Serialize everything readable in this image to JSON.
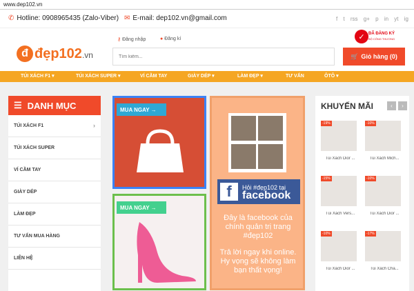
{
  "browser": {
    "url": "www.dep102.vn"
  },
  "topbar": {
    "hotline": "Hotline: 0908965435 (Zalo-Viber)",
    "email": "E-mail: dep102.vn@gmail.com",
    "socials": [
      "f",
      "t",
      "rss",
      "g+",
      "p",
      "in",
      "yt",
      "ig"
    ]
  },
  "header": {
    "logo_mark": "đ",
    "logo_text": "đẹp102",
    "logo_suffix": ".vn",
    "login": "Đăng nhập",
    "register": "Đăng kí",
    "search_placeholder": "Tìm kiếm...",
    "badge_line1": "ĐÃ ĐĂNG KÝ",
    "badge_line2": "BỘ CÔNG THƯƠNG",
    "cart": "Giỏ hàng (0)"
  },
  "nav": [
    {
      "label": "TÚI XÁCH F1 ▾"
    },
    {
      "label": "TÚI XÁCH SUPER ▾"
    },
    {
      "label": "VÍ CẦM TAY"
    },
    {
      "label": "GIÀY DÉP ▾"
    },
    {
      "label": "LÀM ĐẸP ▾"
    },
    {
      "label": "TƯ VẤN"
    },
    {
      "label": "ÔTÔ ▾"
    }
  ],
  "sidebar": {
    "title": "DANH MỤC",
    "items": [
      {
        "label": "TÚI XÁCH F1"
      },
      {
        "label": "TÚI XÁCH SUPER"
      },
      {
        "label": "VÍ CẦM TAY"
      },
      {
        "label": "GIÀY DÉP"
      },
      {
        "label": "LÀM ĐẸP"
      },
      {
        "label": "TƯ VẤN MUA HÀNG"
      },
      {
        "label": "LIÊN HỆ"
      }
    ]
  },
  "promo": {
    "bag_button": "MUA NGAY →",
    "shoe_button": "MUA NGAY →"
  },
  "facebook": {
    "small": "Hỏi #đẹp102 tại",
    "big": "facebook",
    "text1": "Đây là facebook của chính quản trị trang #đẹp102",
    "text2": "Trả lời ngay khi online. Hy vọng sẽ không làm bạn thất vọng!"
  },
  "khuyen_mai": {
    "title": "KHUYẾN MÃI",
    "prev": "‹",
    "next": "›",
    "items": [
      {
        "discount": "-19%",
        "name": "Túi Xách Dior ..."
      },
      {
        "discount": "-10%",
        "name": "Túi Xách Mich..."
      },
      {
        "discount": "-15%",
        "name": "Túi Xách Vers..."
      },
      {
        "discount": "-10%",
        "name": "Túi Xách Dior ..."
      },
      {
        "discount": "-10%",
        "name": "Túi Xách Dior ..."
      },
      {
        "discount": "-17%",
        "name": "Túi Xách Cha..."
      }
    ]
  }
}
